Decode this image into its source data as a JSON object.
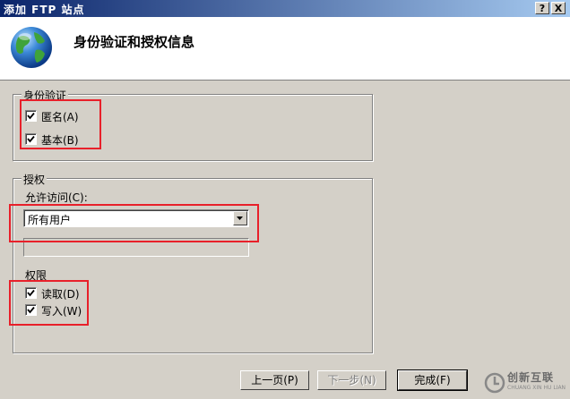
{
  "window": {
    "title": "添加 FTP 站点",
    "help_btn": "?",
    "close_btn": "X"
  },
  "header": {
    "title": "身份验证和授权信息"
  },
  "auth": {
    "legend": "身份验证",
    "anonymous": {
      "label": "匿名(A)",
      "checked": true
    },
    "basic": {
      "label": "基本(B)",
      "checked": true
    }
  },
  "authorization": {
    "legend": "授权",
    "allow_label": "允许访问(C):",
    "allow_value": "所有用户",
    "permissions_label": "权限",
    "read": {
      "label": "读取(D)",
      "checked": true
    },
    "write": {
      "label": "写入(W)",
      "checked": true
    }
  },
  "buttons": {
    "prev": "上一页(P)",
    "next": "下一步(N)",
    "finish": "完成(F)"
  },
  "watermark": {
    "text": "创新互联",
    "sub": "CHUANG XIN HU LIAN"
  },
  "colors": {
    "titlebar": "#0a246a",
    "highlight": "#e8202a",
    "face": "#d4d0c8"
  }
}
